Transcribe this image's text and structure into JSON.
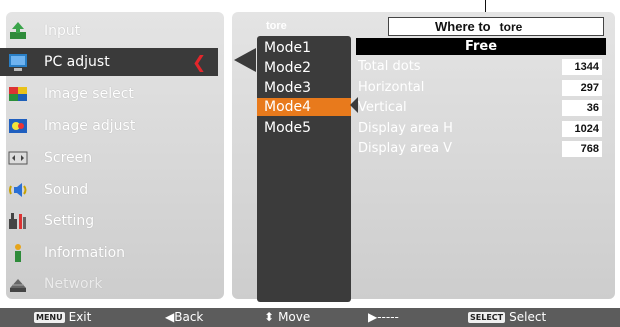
{
  "callout": {
    "text": "Where to",
    "inner": "tore"
  },
  "left_menu": {
    "items": [
      {
        "label": "Input",
        "icon": "input-icon"
      },
      {
        "label": "PC adjust",
        "icon": "pc-adjust-icon"
      },
      {
        "label": "Image select",
        "icon": "image-select-icon"
      },
      {
        "label": "Image adjust",
        "icon": "image-adjust-icon"
      },
      {
        "label": "Screen",
        "icon": "screen-icon"
      },
      {
        "label": "Sound",
        "icon": "sound-icon"
      },
      {
        "label": "Setting",
        "icon": "setting-icon"
      },
      {
        "label": "Information",
        "icon": "information-icon"
      },
      {
        "label": "Network",
        "icon": "network-icon"
      }
    ],
    "selected": "PC adjust"
  },
  "right_panel": {
    "header": "tore",
    "modes": [
      "Mode1",
      "Mode2",
      "Mode3",
      "Mode4",
      "Mode5"
    ],
    "active_mode": "Mode4",
    "free_label": "Free",
    "params": [
      {
        "label": "Total dots",
        "value": "1344"
      },
      {
        "label": "Horizontal",
        "value": "297"
      },
      {
        "label": "Vertical",
        "value": "36"
      },
      {
        "label": "Display area H",
        "value": "1024"
      },
      {
        "label": "Display area V",
        "value": "768"
      }
    ]
  },
  "bottom_bar": {
    "exit_key": "MENU",
    "exit_label": "Exit",
    "back_label": "◀Back",
    "move_label": "Move",
    "dash_label": "▶-----",
    "select_key": "SELECT",
    "select_label": "Select"
  },
  "colors": {
    "accent": "#e87a1c",
    "selected_bg": "#3a3a3a",
    "panel_bg": "#d8d8d8",
    "bar_bg": "#5c5c5c",
    "chevron": "#e3262b"
  }
}
